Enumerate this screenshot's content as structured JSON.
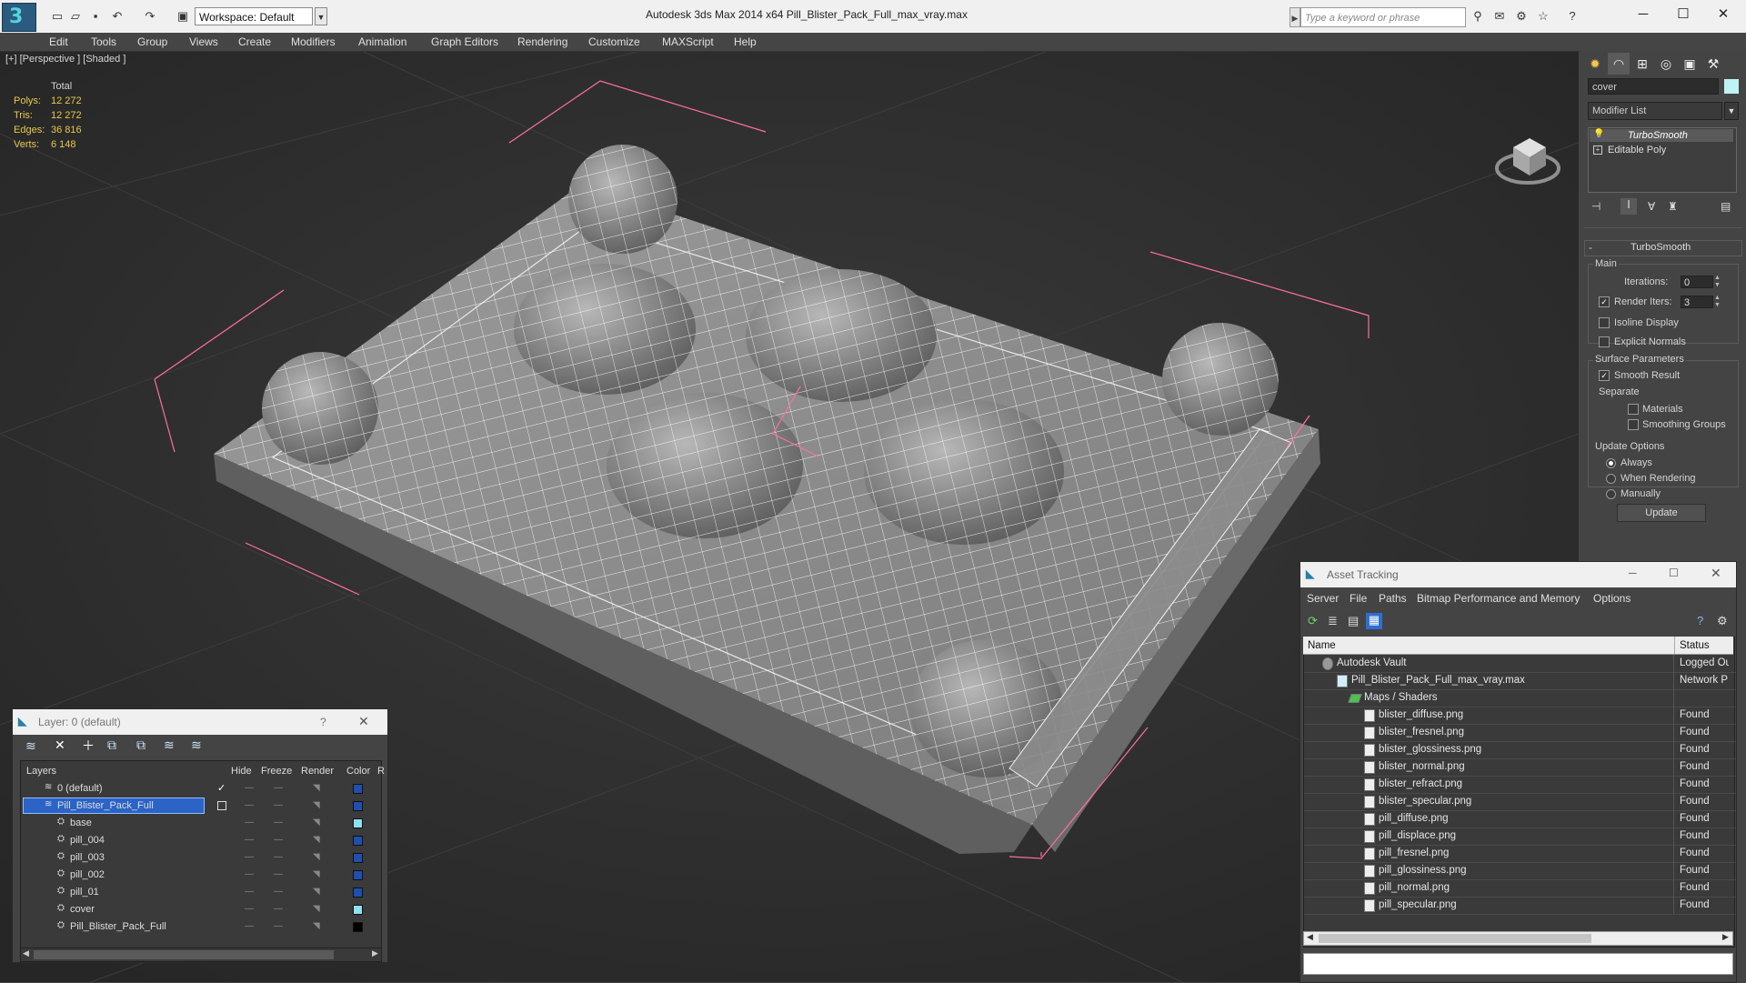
{
  "titlebar": {
    "workspace": "Workspace: Default",
    "app_title": "Autodesk 3ds Max  2014 x64     Pill_Blister_Pack_Full_max_vray.max",
    "search_placeholder": "Type a keyword or phrase"
  },
  "menu": [
    "Edit",
    "Tools",
    "Group",
    "Views",
    "Create",
    "Modifiers",
    "Animation",
    "Graph Editors",
    "Rendering",
    "Customize",
    "MAXScript",
    "Help"
  ],
  "viewport": {
    "label": "[+] [Perspective ] [Shaded ]",
    "stats": {
      "header": "Total",
      "rows": [
        {
          "label": "Polys:",
          "value": "12 272"
        },
        {
          "label": "Tris:",
          "value": "12 272"
        },
        {
          "label": "Edges:",
          "value": "36 816"
        },
        {
          "label": "Verts:",
          "value": "6 148"
        }
      ]
    }
  },
  "command_panel": {
    "object_name": "cover",
    "modifier_list": "Modifier List",
    "stack": [
      "TurboSmooth",
      "Editable Poly"
    ],
    "rollout_title": "TurboSmooth",
    "main_label": "Main",
    "iterations_label": "Iterations:",
    "iterations_value": "0",
    "render_iters_label": "Render Iters:",
    "render_iters_value": "3",
    "isoline": "Isoline Display",
    "explicit_normals": "Explicit Normals",
    "surface_params": "Surface Parameters",
    "smooth_result": "Smooth Result",
    "separate": "Separate",
    "materials": "Materials",
    "smoothing_groups": "Smoothing Groups",
    "update_options": "Update Options",
    "always": "Always",
    "when_rendering": "When Rendering",
    "manually": "Manually",
    "update_button": "Update"
  },
  "layer_dialog": {
    "title": "Layer: 0 (default)",
    "help": "?",
    "columns": [
      "Layers",
      "Hide",
      "Freeze",
      "Render",
      "Color",
      "R"
    ],
    "rows": [
      {
        "name": "0 (default)",
        "color": "#1f4fb0"
      },
      {
        "name": "Pill_Blister_Pack_Full",
        "color": "#1f4fb0"
      },
      {
        "name": "base",
        "color": "#8fe0f0"
      },
      {
        "name": "pill_004",
        "color": "#1f4fb0"
      },
      {
        "name": "pill_003",
        "color": "#1f4fb0"
      },
      {
        "name": "pill_002",
        "color": "#1f4fb0"
      },
      {
        "name": "pill_01",
        "color": "#1f4fb0"
      },
      {
        "name": "cover",
        "color": "#8fe0f0"
      },
      {
        "name": "Pill_Blister_Pack_Full",
        "color": "#000000"
      }
    ]
  },
  "asset_tracking": {
    "title": "Asset Tracking",
    "menu": [
      "Server",
      "File",
      "Paths",
      "Bitmap Performance and Memory",
      "Options"
    ],
    "columns": [
      "Name",
      "Status"
    ],
    "rows": [
      {
        "name": "Autodesk Vault",
        "status": "Logged Ou"
      },
      {
        "name": "Pill_Blister_Pack_Full_max_vray.max",
        "status": "Network P"
      },
      {
        "name": "Maps / Shaders",
        "status": ""
      },
      {
        "name": "blister_diffuse.png",
        "status": "Found"
      },
      {
        "name": "blister_fresnel.png",
        "status": "Found"
      },
      {
        "name": "blister_glossiness.png",
        "status": "Found"
      },
      {
        "name": "blister_normal.png",
        "status": "Found"
      },
      {
        "name": "blister_refract.png",
        "status": "Found"
      },
      {
        "name": "blister_specular.png",
        "status": "Found"
      },
      {
        "name": "pill_diffuse.png",
        "status": "Found"
      },
      {
        "name": "pill_displace.png",
        "status": "Found"
      },
      {
        "name": "pill_fresnel.png",
        "status": "Found"
      },
      {
        "name": "pill_glossiness.png",
        "status": "Found"
      },
      {
        "name": "pill_normal.png",
        "status": "Found"
      },
      {
        "name": "pill_specular.png",
        "status": "Found"
      }
    ]
  },
  "colors": {
    "accent": "#3399ff",
    "selection": "#2b63c6",
    "stats_text": "#e8c94a",
    "bbox_pink": "#ff6fa0"
  }
}
